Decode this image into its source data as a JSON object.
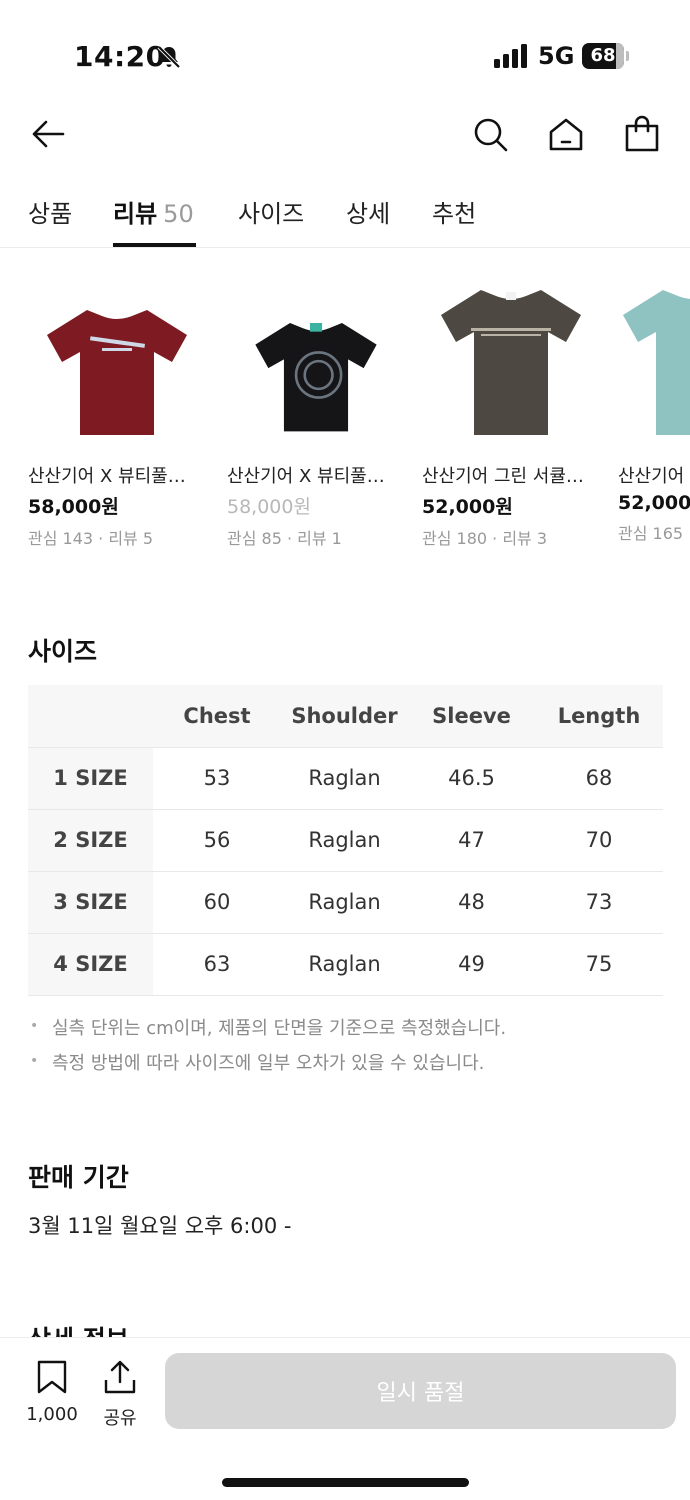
{
  "status_bar": {
    "time": "14:20",
    "network": "5G",
    "battery": "68"
  },
  "tabs": [
    {
      "label": "상품",
      "count": ""
    },
    {
      "label": "리뷰",
      "count": "50"
    },
    {
      "label": "사이즈",
      "count": ""
    },
    {
      "label": "상세",
      "count": ""
    },
    {
      "label": "추천",
      "count": ""
    }
  ],
  "active_tab": "리뷰",
  "recommended_products": [
    {
      "name": "산산기어 X 뷰티풀…",
      "price": "58,000원",
      "price_state": "normal",
      "meta": "관심 143 · 리뷰 5",
      "shirt_color": "#7d1a22"
    },
    {
      "name": "산산기어 X 뷰티풀…",
      "price": "58,000원",
      "price_state": "sold-out",
      "meta": "관심 85 · 리뷰 1",
      "shirt_color": "#151517"
    },
    {
      "name": "산산기어 그린 서큘…",
      "price": "52,000원",
      "price_state": "normal",
      "meta": "관심 180 · 리뷰 3",
      "shirt_color": "#4d4842"
    },
    {
      "name": "산산기어",
      "price": "52,000",
      "price_state": "normal",
      "meta": "관심 165",
      "shirt_color": "#8fc3c2"
    }
  ],
  "size_section": {
    "title": "사이즈",
    "headers": [
      "",
      "Chest",
      "Shoulder",
      "Sleeve",
      "Length"
    ],
    "rows": [
      {
        "size": "1 SIZE",
        "chest": "53",
        "shoulder": "Raglan",
        "sleeve": "46.5",
        "length": "68"
      },
      {
        "size": "2 SIZE",
        "chest": "56",
        "shoulder": "Raglan",
        "sleeve": "47",
        "length": "70"
      },
      {
        "size": "3 SIZE",
        "chest": "60",
        "shoulder": "Raglan",
        "sleeve": "48",
        "length": "73"
      },
      {
        "size": "4 SIZE",
        "chest": "63",
        "shoulder": "Raglan",
        "sleeve": "49",
        "length": "75"
      }
    ],
    "notes": [
      "실측 단위는 cm이며, 제품의 단면을 기준으로 측정했습니다.",
      "측정 방법에 따라 사이즈에 일부 오차가 있을 수 있습니다."
    ]
  },
  "sale_period": {
    "title": "판매 기간",
    "value": "3월 11일 월요일 오후 6:00 -"
  },
  "detail_section": {
    "title": "상세 정보"
  },
  "bottom_bar": {
    "like_count": "1,000",
    "share_label": "공유",
    "buy_button": "일시 품절"
  }
}
